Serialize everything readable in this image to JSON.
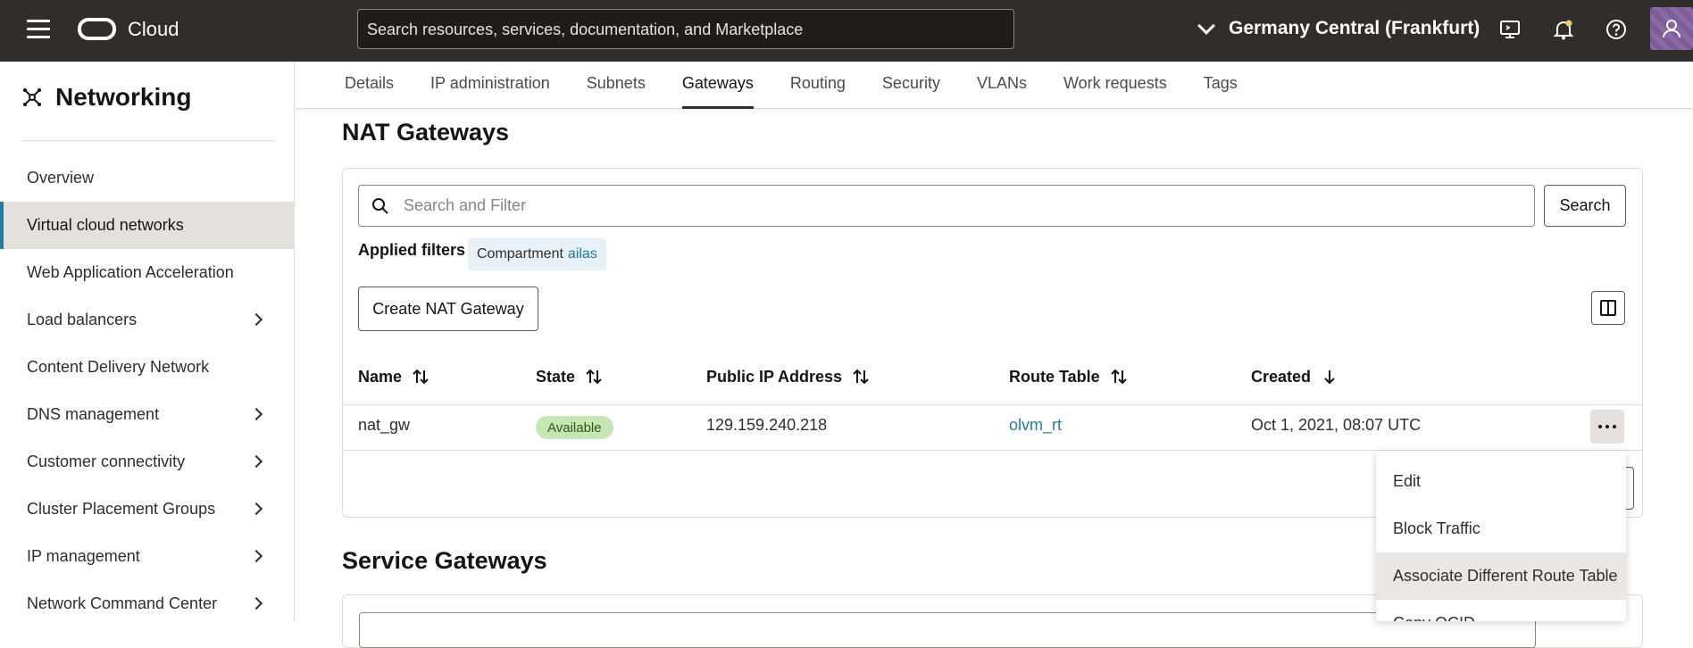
{
  "header": {
    "brand": "Cloud",
    "search_placeholder": "Search resources, services, documentation, and Marketplace",
    "region": "Germany Central (Frankfurt)",
    "icons": [
      "menu-icon",
      "cloud-shell-icon",
      "bell-icon",
      "help-icon",
      "profile-icon"
    ]
  },
  "sidebar": {
    "title": "Networking",
    "items": [
      {
        "label": "Overview",
        "active": false,
        "expandable": false
      },
      {
        "label": "Virtual cloud networks",
        "active": true,
        "expandable": false
      },
      {
        "label": "Web Application Acceleration",
        "active": false,
        "expandable": false
      },
      {
        "label": "Load balancers",
        "active": false,
        "expandable": true
      },
      {
        "label": "Content Delivery Network",
        "active": false,
        "expandable": false
      },
      {
        "label": "DNS management",
        "active": false,
        "expandable": true
      },
      {
        "label": "Customer connectivity",
        "active": false,
        "expandable": true
      },
      {
        "label": "Cluster Placement Groups",
        "active": false,
        "expandable": true
      },
      {
        "label": "IP management",
        "active": false,
        "expandable": true
      },
      {
        "label": "Network Command Center",
        "active": false,
        "expandable": true
      }
    ]
  },
  "tabs": [
    "Details",
    "IP administration",
    "Subnets",
    "Gateways",
    "Routing",
    "Security",
    "VLANs",
    "Work requests",
    "Tags"
  ],
  "active_tab": "Gateways",
  "nat": {
    "title": "NAT Gateways",
    "filter_placeholder": "Search and Filter",
    "search_button": "Search",
    "applied_filters_label": "Applied filters",
    "chip_key": "Compartment",
    "chip_value": "ailas",
    "create_button": "Create NAT Gateway",
    "columns": [
      "Name",
      "State",
      "Public IP Address",
      "Route Table",
      "Created"
    ],
    "rows": [
      {
        "name": "nat_gw",
        "state": "Available",
        "public_ip": "129.159.240.218",
        "route_table": "olvm_rt",
        "created": "Oct 1, 2021, 08:07 UTC"
      }
    ]
  },
  "service": {
    "title": "Service Gateways"
  },
  "menu": {
    "items": [
      "Edit",
      "Block Traffic",
      "Associate Different Route Table",
      "Copy OCID"
    ],
    "hovered": "Associate Different Route Table"
  },
  "colors": {
    "header_bg": "#312d2a",
    "link": "#227e9e",
    "badge_bg": "#c6e6b4",
    "active_nav_bg": "#e4e1dd"
  }
}
